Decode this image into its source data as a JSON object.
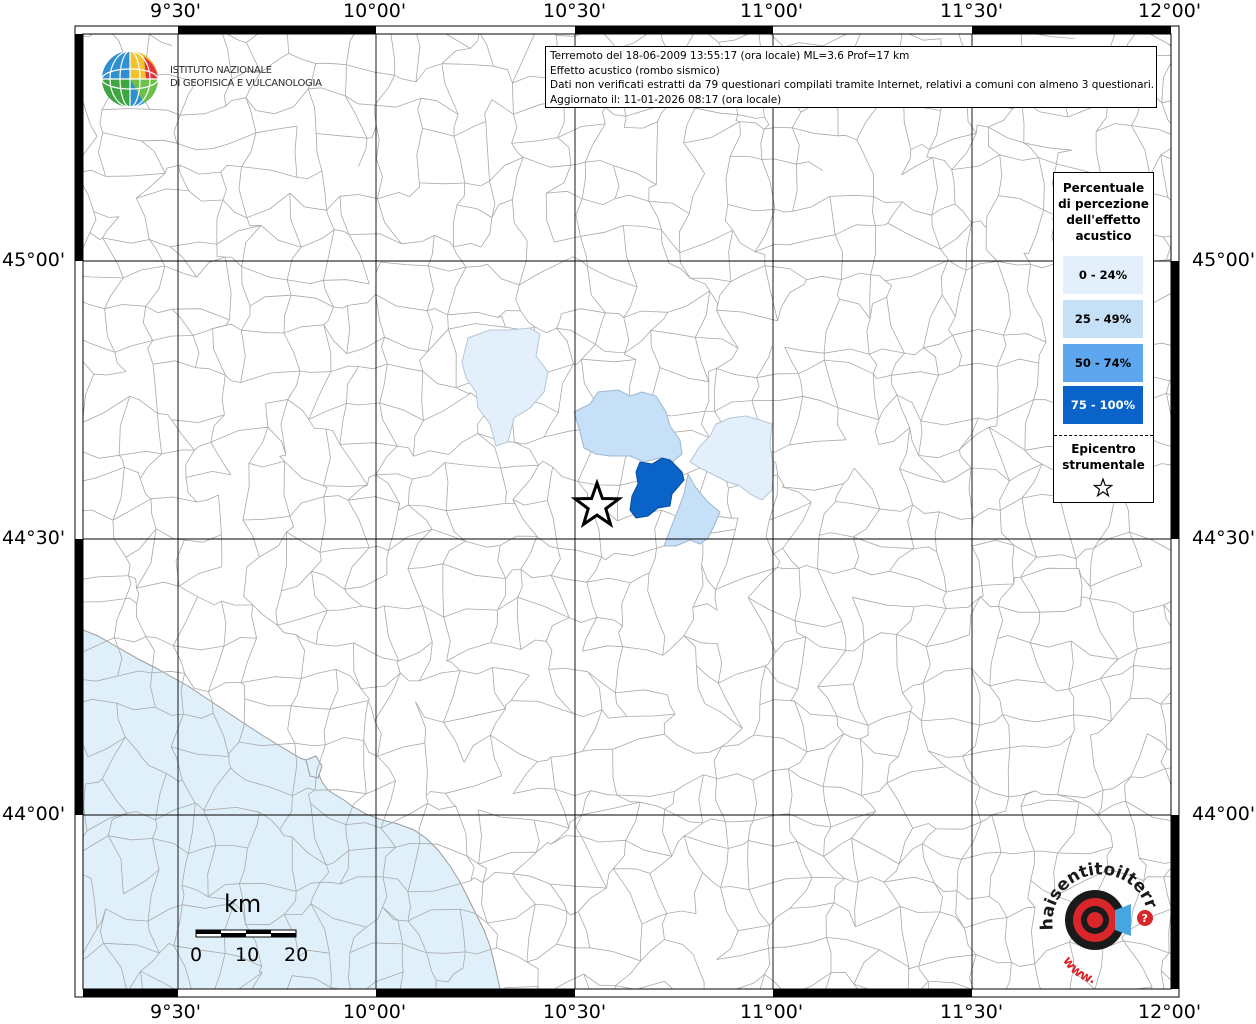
{
  "header": {
    "line1": "Terremoto del 18-06-2009 13:55:17 (ora locale) ML=3.6 Prof=17 km",
    "line2": "Effetto acustico (rombo sismico)",
    "line3": "Dati non verificati estratti da 79 questionari compilati tramite Internet, relativi a comuni con almeno 3 questionari.",
    "line4": "Aggiornato il: 11-01-2026 08:17 (ora locale)"
  },
  "institute": {
    "line1": "ISTITUTO NAZIONALE",
    "line2": "DI GEOFISICA E VULCANOLOGIA"
  },
  "legend": {
    "title_lines": [
      "Percentuale",
      "di percezione",
      "dell'effetto",
      "acustico"
    ],
    "classes": [
      {
        "label": "0 - 24%",
        "color": "#e3f0fc",
        "text_color": "#000000"
      },
      {
        "label": "25 - 49%",
        "color": "#c6e0f8",
        "text_color": "#000000"
      },
      {
        "label": "50 - 74%",
        "color": "#5ea7ee",
        "text_color": "#000000"
      },
      {
        "label": "75 - 100%",
        "color": "#0a63c8",
        "text_color": "#ffffff"
      }
    ],
    "epicenter_lines": [
      "Epicentro",
      "strumentale"
    ],
    "epicenter_symbol": "star-icon"
  },
  "scale_bar": {
    "unit": "km",
    "ticks": [
      "0",
      "10",
      "20"
    ]
  },
  "axes": {
    "top_labels": [
      "9°30'",
      "10°00'",
      "10°30'",
      "11°00'",
      "11°30'",
      "12°00'"
    ],
    "bottom_labels": [
      "9°30'",
      "10°00'",
      "10°30'",
      "11°00'",
      "11°30'",
      "12°00'"
    ],
    "left_labels": [
      "45°00'",
      "44°30'",
      "44°00'"
    ],
    "right_labels": [
      "45°00'",
      "44°30'",
      "44°00'"
    ]
  },
  "hst_logo": {
    "text": "haisentitoilterremoto.it",
    "prefix": "www."
  },
  "colors": {
    "sea": "#dff0fb",
    "border": "#000000",
    "municipal_lines": "#a9a9a9",
    "grid": "#000000"
  }
}
